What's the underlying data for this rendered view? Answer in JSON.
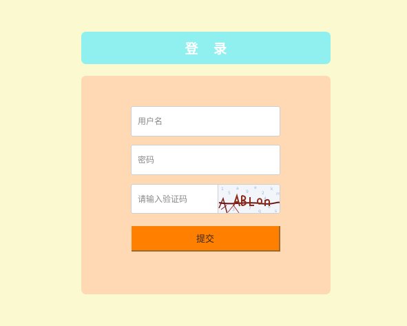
{
  "header": {
    "title": "登 录"
  },
  "form": {
    "username_placeholder": "用户名",
    "password_placeholder": "密码",
    "captcha_placeholder": "请输入验证码",
    "submit_label": "提交"
  },
  "colors": {
    "background": "#fbf9d0",
    "title_bar": "#8ff0ef",
    "panel": "#fed9b4",
    "submit_button": "#ff7f00"
  }
}
